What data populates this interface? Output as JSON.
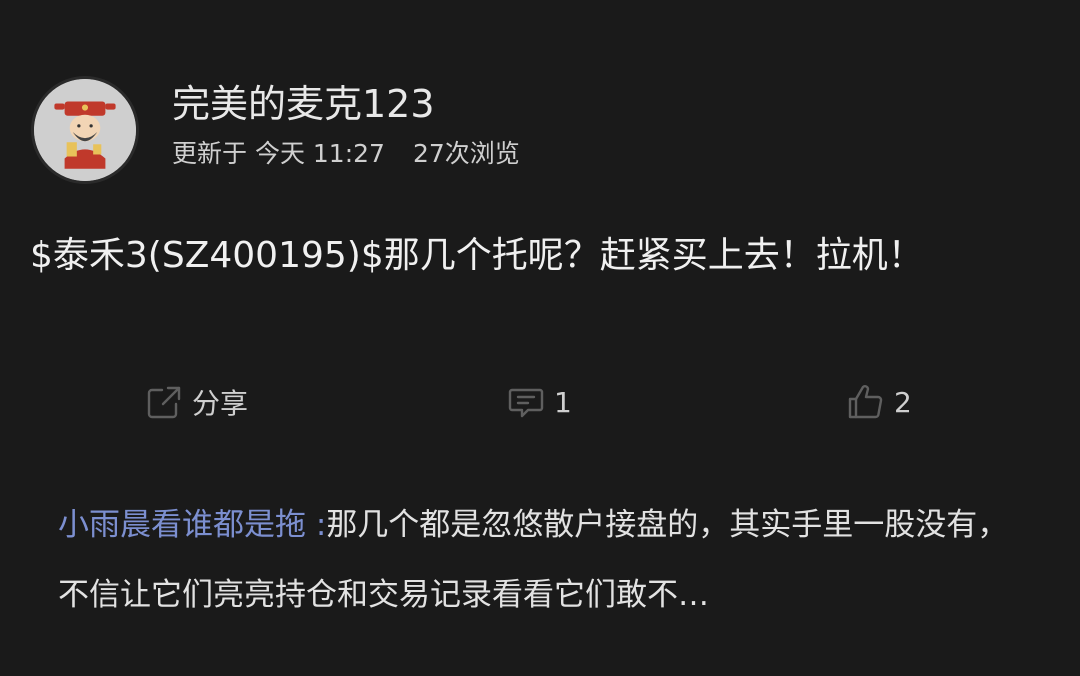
{
  "user": {
    "name": "完美的麦克123",
    "updated": "更新于 今天 11:27",
    "views": "27次浏览"
  },
  "post": {
    "text": "$泰禾3(SZ400195)$那几个托呢？赶紧买上去！拉机！"
  },
  "actions": {
    "share_label": "分享",
    "comment_count": "1",
    "like_count": "2"
  },
  "reply": {
    "author": "小雨晨看谁都是拖 :",
    "text": "那几个都是忽悠散户接盘的，其实手里一股没有，不信让它们亮亮持仓和交易记录看看它们敢不…"
  },
  "colors": {
    "background": "#1a1a1a",
    "reply_author": "#7c8fd0"
  }
}
